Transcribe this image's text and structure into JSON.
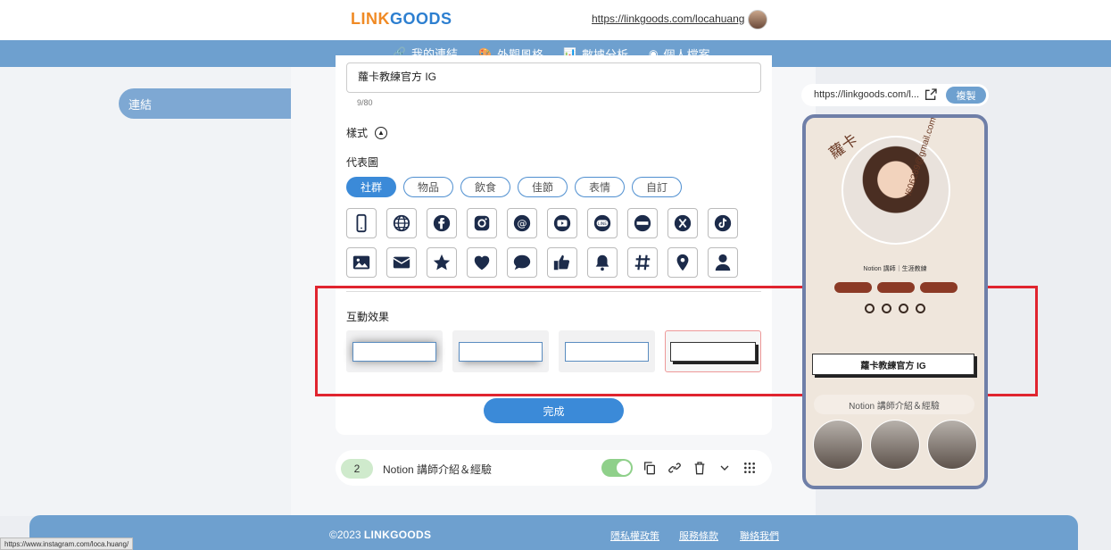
{
  "header": {
    "logo": "LINKGOODS",
    "profile_url": "https://linkgoods.com/locahuang"
  },
  "nav": {
    "items": [
      {
        "label": "我的連結"
      },
      {
        "label": "外觀風格"
      },
      {
        "label": "數據分析"
      },
      {
        "label": "個人檔案"
      }
    ]
  },
  "sidebar": {
    "active_label": "連結"
  },
  "editor": {
    "title_value": "蘿卡教練官方 IG",
    "char_counter": "9/80",
    "style_label": "樣式",
    "representative_label": "代表圖",
    "categories": [
      "社群",
      "物品",
      "飲食",
      "佳節",
      "表情",
      "自訂"
    ],
    "active_category": "社群",
    "interaction_label": "互動效果",
    "done_label": "完成"
  },
  "link_row": {
    "number": "2",
    "title": "Notion 講師介紹＆經驗"
  },
  "preview": {
    "url": "https://linkgoods.com/l...",
    "copy_label": "複製",
    "name": "蘿卡",
    "email": "l606289@gmail.com",
    "subtitle": "Notion 講師｜生涯教練",
    "button_label": "蘿卡教練官方 IG",
    "section_title": "Notion 講師介紹＆經驗"
  },
  "footer": {
    "copyright": "©2023",
    "brand": "LINKGOODS",
    "links": [
      "隱私權政策",
      "服務條款",
      "聯絡我們"
    ]
  },
  "status_bar": {
    "url": "https://www.instagram.com/loca.huang/"
  },
  "colors": {
    "nav": "#6ea0cf",
    "primary": "#3b8ad8",
    "highlight": "#e0242f"
  }
}
